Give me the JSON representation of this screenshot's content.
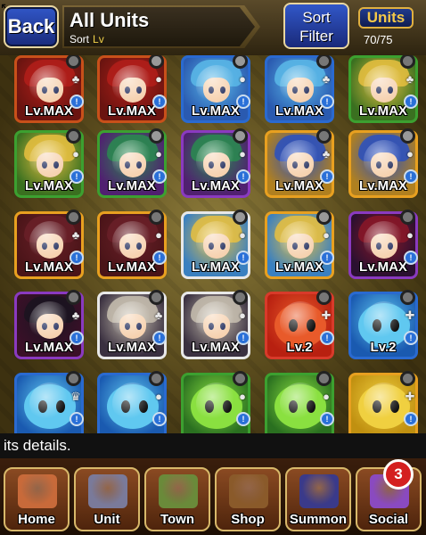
{
  "header": {
    "back_label": "Back",
    "title": "All Units",
    "sort_label": "Sort",
    "sort_value": "Lv",
    "sort_filter_label_1": "Sort",
    "sort_filter_label_2": "Filter",
    "units_label": "Units",
    "units_count": "70/75"
  },
  "units": [
    {
      "level": "Lv.MAX",
      "type": "hero",
      "border": "#c8501a",
      "hair": "#b31f1a",
      "bg": "#6a1410",
      "fav": true,
      "badge": "trophy"
    },
    {
      "level": "Lv.MAX",
      "type": "hero",
      "border": "#c8501a",
      "hair": "#b31f1a",
      "bg": "#6a1410",
      "fav": false,
      "badge": "ring"
    },
    {
      "level": "Lv.MAX",
      "type": "hero",
      "border": "#2a6ad0",
      "hair": "#5ab8e8",
      "bg": "#2a5ab0",
      "fav": false,
      "badge": "ring"
    },
    {
      "level": "Lv.MAX",
      "type": "hero",
      "border": "#2a6ad0",
      "hair": "#5ab8e8",
      "bg": "#2a5ab0",
      "fav": true,
      "badge": "trophy"
    },
    {
      "level": "Lv.MAX",
      "type": "hero",
      "border": "#3ca030",
      "hair": "#e8c040",
      "bg": "#3a7020",
      "fav": true,
      "badge": "trophy"
    },
    {
      "level": "Lv.MAX",
      "type": "hero",
      "border": "#3ca030",
      "hair": "#e8c040",
      "bg": "#3a7020",
      "fav": true,
      "badge": "ring"
    },
    {
      "level": "Lv.MAX",
      "type": "hero",
      "border": "#3ca030",
      "hair": "#2a8a50",
      "bg": "#502070",
      "fav": false,
      "badge": "ring"
    },
    {
      "level": "Lv.MAX",
      "type": "hero",
      "border": "#8a3ac0",
      "hair": "#2a8a50",
      "bg": "#502070",
      "fav": false,
      "badge": "ring"
    },
    {
      "level": "Lv.MAX",
      "type": "hero",
      "border": "#e8a020",
      "hair": "#2a50c0",
      "bg": "#b08020",
      "fav": true,
      "badge": "trophy"
    },
    {
      "level": "Lv.MAX",
      "type": "hero",
      "border": "#e8a020",
      "hair": "#2a50c0",
      "bg": "#b08020",
      "fav": false,
      "badge": "ring"
    },
    {
      "level": "Lv.MAX",
      "type": "hero",
      "border": "#e8a020",
      "hair": "#6a2028",
      "bg": "#4a1418",
      "fav": true,
      "badge": "trophy"
    },
    {
      "level": "Lv.MAX",
      "type": "hero",
      "border": "#e8a020",
      "hair": "#6a2028",
      "bg": "#4a1418",
      "fav": true,
      "badge": "ring"
    },
    {
      "level": "Lv.MAX",
      "type": "hero",
      "border": "#e8e8e8",
      "hair": "#e8c040",
      "bg": "#3a80c0",
      "fav": false,
      "badge": "ring"
    },
    {
      "level": "Lv.MAX",
      "type": "hero",
      "border": "#e8a020",
      "hair": "#e8c040",
      "bg": "#3a80c0",
      "fav": false,
      "badge": "ring"
    },
    {
      "level": "Lv.MAX",
      "type": "hero",
      "border": "#8a3ac0",
      "hair": "#8a1828",
      "bg": "#2a1030",
      "fav": true,
      "badge": "ring"
    },
    {
      "level": "Lv.MAX",
      "type": "hero",
      "border": "#8a3ac0",
      "hair": "#1a1420",
      "bg": "#3a1028",
      "fav": true,
      "badge": "trophy"
    },
    {
      "level": "Lv.MAX",
      "type": "hero",
      "border": "#e8e8e8",
      "hair": "#c8c0b0",
      "bg": "#3a3040",
      "fav": true,
      "badge": "trophy"
    },
    {
      "level": "Lv.MAX",
      "type": "hero",
      "border": "#e8e8e8",
      "hair": "#c8c0b0",
      "bg": "#3a3040",
      "fav": true,
      "badge": "ring"
    },
    {
      "level": "Lv.2",
      "type": "blob",
      "border": "#d83a2a",
      "hair": "#e85a2a",
      "bg": "#b82010",
      "fav": true,
      "badge": "plus"
    },
    {
      "level": "Lv.2",
      "type": "blob",
      "border": "#2a6ad0",
      "hair": "#60c8f0",
      "bg": "#1a5ab0",
      "fav": true,
      "badge": "plus"
    },
    {
      "level": "",
      "type": "blob",
      "border": "#2a6ad0",
      "hair": "#60c8f0",
      "bg": "#1a5ab0",
      "fav": true,
      "badge": "crown"
    },
    {
      "level": "",
      "type": "blob",
      "border": "#2a6ad0",
      "hair": "#60c8f0",
      "bg": "#1a5ab0",
      "fav": true,
      "badge": "ring"
    },
    {
      "level": "",
      "type": "blob",
      "border": "#3ca030",
      "hair": "#8ae040",
      "bg": "#2a7020",
      "fav": true,
      "badge": "ring"
    },
    {
      "level": "",
      "type": "blob",
      "border": "#3ca030",
      "hair": "#8ae040",
      "bg": "#2a7020",
      "fav": true,
      "badge": "ring"
    },
    {
      "level": "",
      "type": "blob",
      "border": "#e8a020",
      "hair": "#f0d040",
      "bg": "#c09010",
      "fav": true,
      "badge": "plus"
    }
  ],
  "message": "its details.",
  "nav": [
    {
      "label": "Home",
      "color": "#c86a3a",
      "icon": "home-icon"
    },
    {
      "label": "Unit",
      "color": "#7a7a9a",
      "icon": "knight-icon"
    },
    {
      "label": "Town",
      "color": "#6a8a3a",
      "icon": "town-icon"
    },
    {
      "label": "Shop",
      "color": "#8a5a2a",
      "icon": "gem-shop-icon"
    },
    {
      "label": "Summon",
      "color": "#3a3a8a",
      "icon": "summon-gate-icon"
    },
    {
      "label": "Social",
      "color": "#8a4ac0",
      "icon": "social-heart-icon"
    }
  ],
  "social_notification": "3"
}
